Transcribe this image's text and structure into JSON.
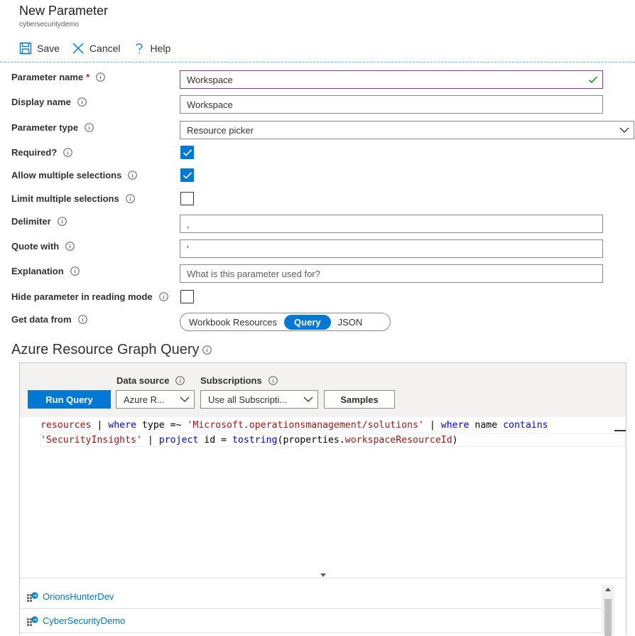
{
  "header": {
    "title": "New Parameter",
    "subtitle": "cybersecuritydemo",
    "toolbar": {
      "save_label": "Save",
      "cancel_label": "Cancel",
      "help_label": "Help"
    }
  },
  "form": {
    "parameter_name": {
      "label": "Parameter name",
      "required_mark": "*",
      "value": "Workspace"
    },
    "display_name": {
      "label": "Display name",
      "value": "Workspace"
    },
    "parameter_type": {
      "label": "Parameter type",
      "value": "Resource picker"
    },
    "required": {
      "label": "Required?",
      "checked": true
    },
    "allow_multiple": {
      "label": "Allow multiple selections",
      "checked": true
    },
    "limit_multiple": {
      "label": "Limit multiple selections",
      "checked": false
    },
    "delimiter": {
      "label": "Delimiter",
      "value": ","
    },
    "quote_with": {
      "label": "Quote with",
      "value": "'"
    },
    "explanation": {
      "label": "Explanation",
      "placeholder": "What is this parameter used for?"
    },
    "hide_in_reading": {
      "label": "Hide parameter in reading mode",
      "checked": false
    },
    "get_data_from": {
      "label": "Get data from",
      "options": [
        "Workbook Resources",
        "Query",
        "JSON"
      ],
      "selected": "Query"
    }
  },
  "query": {
    "title": "Azure Resource Graph Query",
    "run_label": "Run Query",
    "data_source": {
      "label": "Data source",
      "value": "Azure R..."
    },
    "subscriptions": {
      "label": "Subscriptions",
      "value": "Use all Subscripti..."
    },
    "samples_label": "Samples",
    "code": {
      "l1_t1": "resources",
      "l1_t2": " | ",
      "l1_t3": "where",
      "l1_t4": " type =~ ",
      "l1_t5": "'Microsoft.operationsmanagement/solutions'",
      "l1_t6": " | ",
      "l1_t7": "where",
      "l1_t8": " name ",
      "l1_t9": "contains",
      "l2_t1": "'SecurityInsights'",
      "l2_t2": " | ",
      "l2_t3": "project",
      "l2_t4": " id = ",
      "l2_t5": "tostring",
      "l2_t6": "(properties.",
      "l2_t7": "workspaceResourceId",
      "l2_t8": ")"
    },
    "results": [
      "OrionsHunterDev",
      "CyberSecurityDemo"
    ]
  },
  "colors": {
    "accent": "#0078d4",
    "focus_border": "#8c3a8c",
    "valid_check": "#107c10"
  }
}
